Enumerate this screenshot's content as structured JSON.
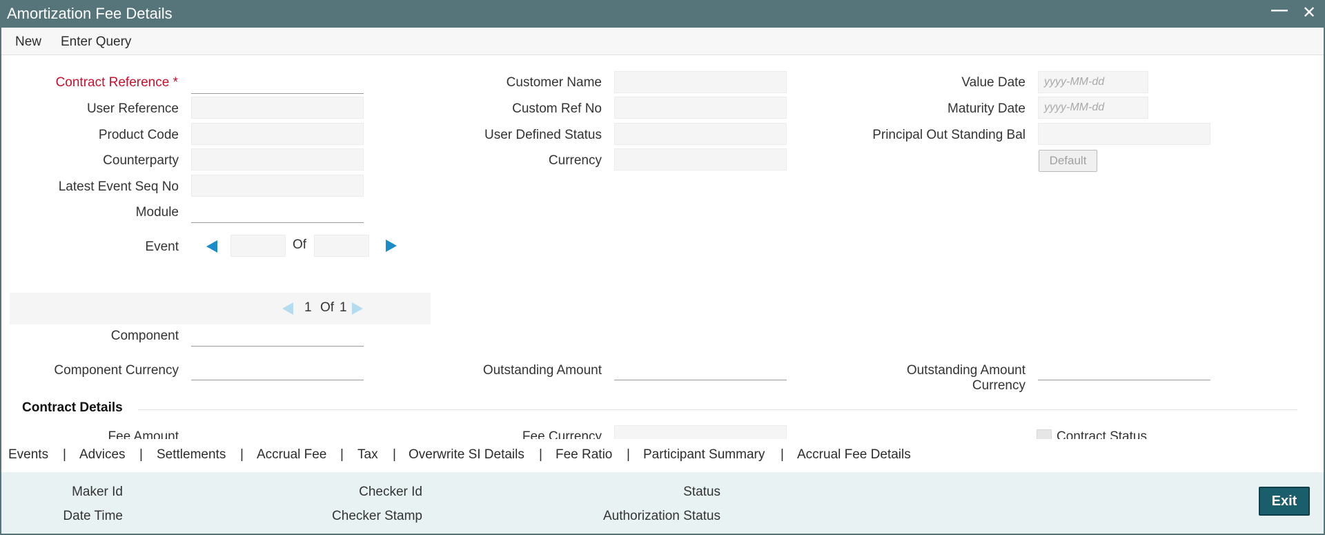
{
  "window": {
    "title": "Amortization Fee Details",
    "minimize_icon": "minimize-icon",
    "close_icon": "close-icon"
  },
  "menu": {
    "new": "New",
    "enter_query": "Enter Query"
  },
  "left": {
    "contract_reference": "Contract Reference",
    "required_marker": "*",
    "user_reference": "User Reference",
    "product_code": "Product Code",
    "counterparty": "Counterparty",
    "latest_event_seq_no": "Latest Event Seq No",
    "module": "Module",
    "event": "Event",
    "of": "Of"
  },
  "middle": {
    "customer_name": "Customer Name",
    "custom_ref_no": "Custom Ref No",
    "user_defined_status": "User Defined Status",
    "currency": "Currency"
  },
  "right": {
    "value_date": "Value Date",
    "value_date_placeholder": "yyyy-MM-dd",
    "maturity_date": "Maturity Date",
    "maturity_date_placeholder": "yyyy-MM-dd",
    "principal_outstanding_bal": "Principal Out Standing Bal",
    "default_button": "Default"
  },
  "pager": {
    "current": "1",
    "of": "Of",
    "total": "1"
  },
  "component": {
    "component": "Component",
    "component_currency": "Component Currency",
    "outstanding_amount": "Outstanding Amount",
    "outstanding_amount_currency": "Outstanding Amount Currency"
  },
  "contract_details": {
    "title": "Contract Details",
    "fee_amount": "Fee Amount",
    "fee_currency": "Fee Currency",
    "contract_status": "Contract Status"
  },
  "tabs": [
    "Events",
    "Advices",
    "Settlements",
    "Accrual Fee",
    "Tax",
    "Overwrite SI Details",
    "Fee Ratio",
    "Participant Summary",
    "Accrual Fee Details"
  ],
  "tab_separator": "|",
  "footer": {
    "maker_id": "Maker Id",
    "date_time": "Date Time",
    "checker_id": "Checker Id",
    "checker_stamp": "Checker Stamp",
    "status": "Status",
    "authorization_status": "Authorization Status",
    "exit_button": "Exit"
  },
  "colors": {
    "titlebar": "#56757b",
    "nav_arrow": "#1a8cc8",
    "required": "#c8102e",
    "footer_bg": "#e8f2f3",
    "exit_button": "#1b5e6b"
  }
}
